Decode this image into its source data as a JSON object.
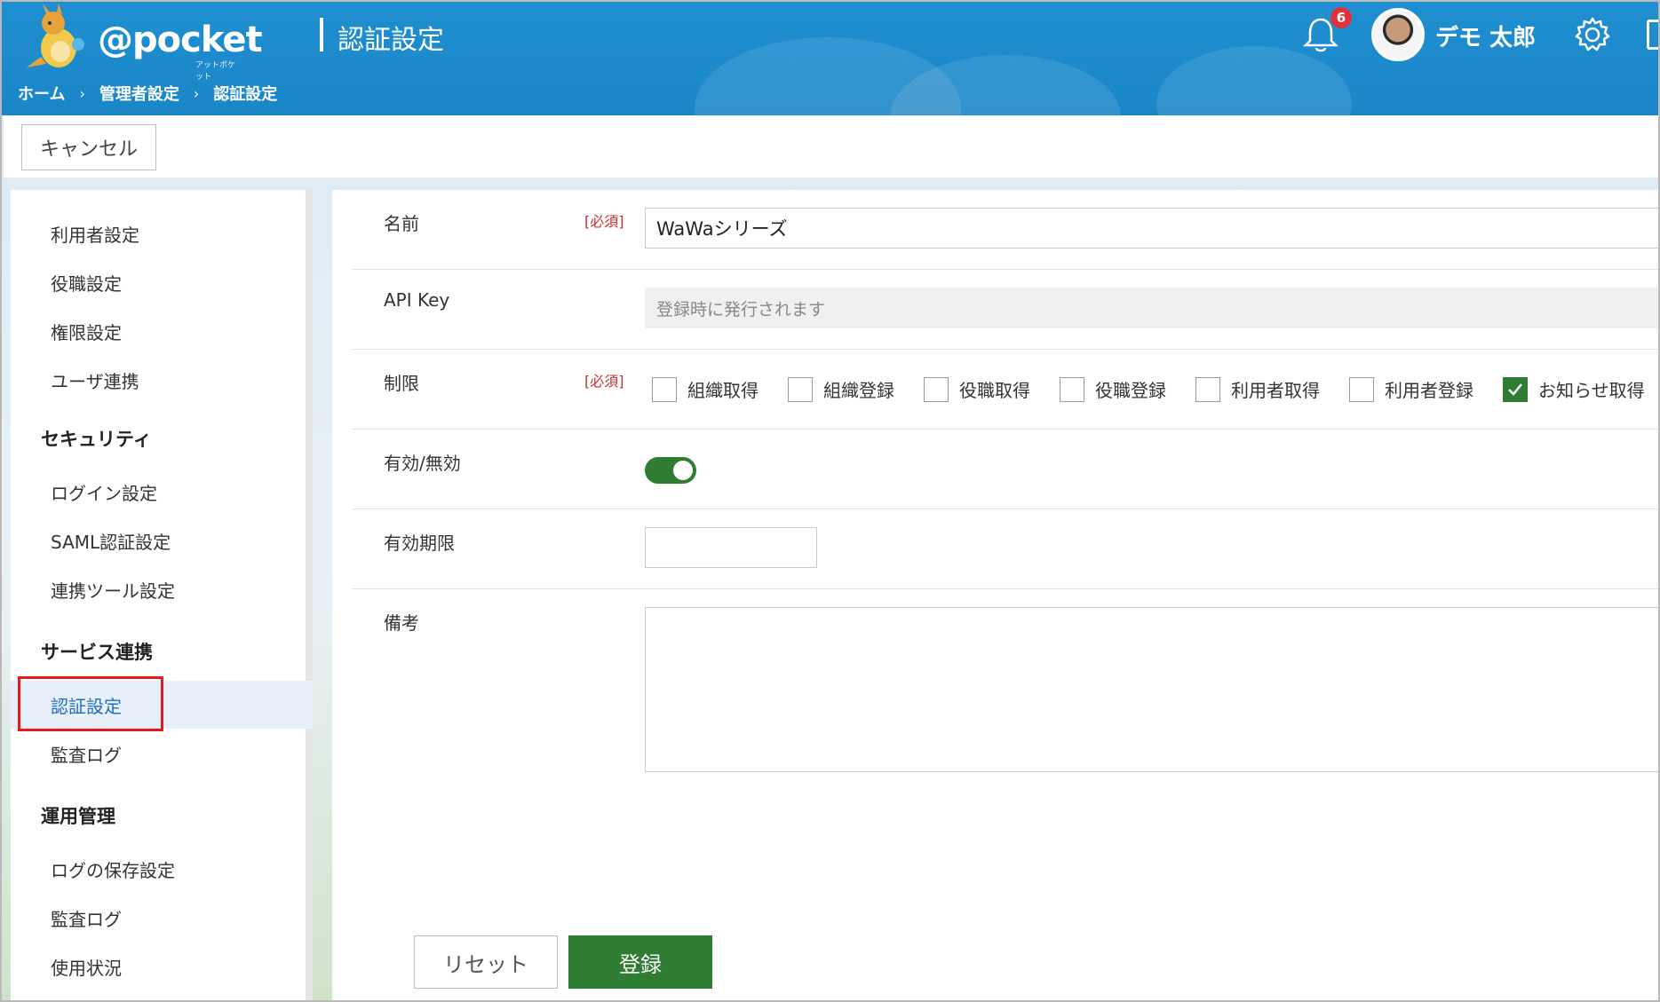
{
  "header": {
    "logo_text": "@pocket",
    "logo_subtext": "アットポケット",
    "page_title": "認証設定",
    "breadcrumb": [
      "ホーム",
      "管理者設定",
      "認証設定"
    ],
    "breadcrumb_separator": "›",
    "notification_count": "6",
    "user_name": "デモ 太郎"
  },
  "toolbar": {
    "cancel_label": "キャンセル"
  },
  "sidebar": {
    "groups": [
      {
        "title": "",
        "items": [
          "利用者設定",
          "役職設定",
          "権限設定",
          "ユーザ連携"
        ]
      },
      {
        "title": "セキュリティ",
        "items": [
          "ログイン設定",
          "SAML認証設定",
          "連携ツール設定"
        ]
      },
      {
        "title": "サービス連携",
        "items": [
          "認証設定",
          "監査ログ"
        ]
      },
      {
        "title": "運用管理",
        "items": [
          "ログの保存設定",
          "監査ログ",
          "使用状況"
        ]
      }
    ],
    "active_item": "認証設定"
  },
  "form": {
    "name": {
      "label": "名前",
      "required": "[必須]",
      "value": "WaWaシリーズ"
    },
    "api_key": {
      "label": "API Key",
      "placeholder": "登録時に発行されます"
    },
    "limits": {
      "label": "制限",
      "required": "[必須]",
      "options": [
        {
          "label": "組織取得",
          "checked": false
        },
        {
          "label": "組織登録",
          "checked": false
        },
        {
          "label": "役職取得",
          "checked": false
        },
        {
          "label": "役職登録",
          "checked": false
        },
        {
          "label": "利用者取得",
          "checked": false
        },
        {
          "label": "利用者登録",
          "checked": false
        },
        {
          "label": "お知らせ取得",
          "checked": true
        }
      ]
    },
    "enabled": {
      "label": "有効/無効",
      "on": true
    },
    "expiry": {
      "label": "有効期限",
      "value": ""
    },
    "notes": {
      "label": "備考",
      "value": ""
    }
  },
  "actions": {
    "reset_label": "リセット",
    "submit_label": "登録"
  },
  "colors": {
    "header": "#1f8fd0",
    "primary": "#2e7d32",
    "required": "#c9302c",
    "highlight": "#e41c1c"
  }
}
